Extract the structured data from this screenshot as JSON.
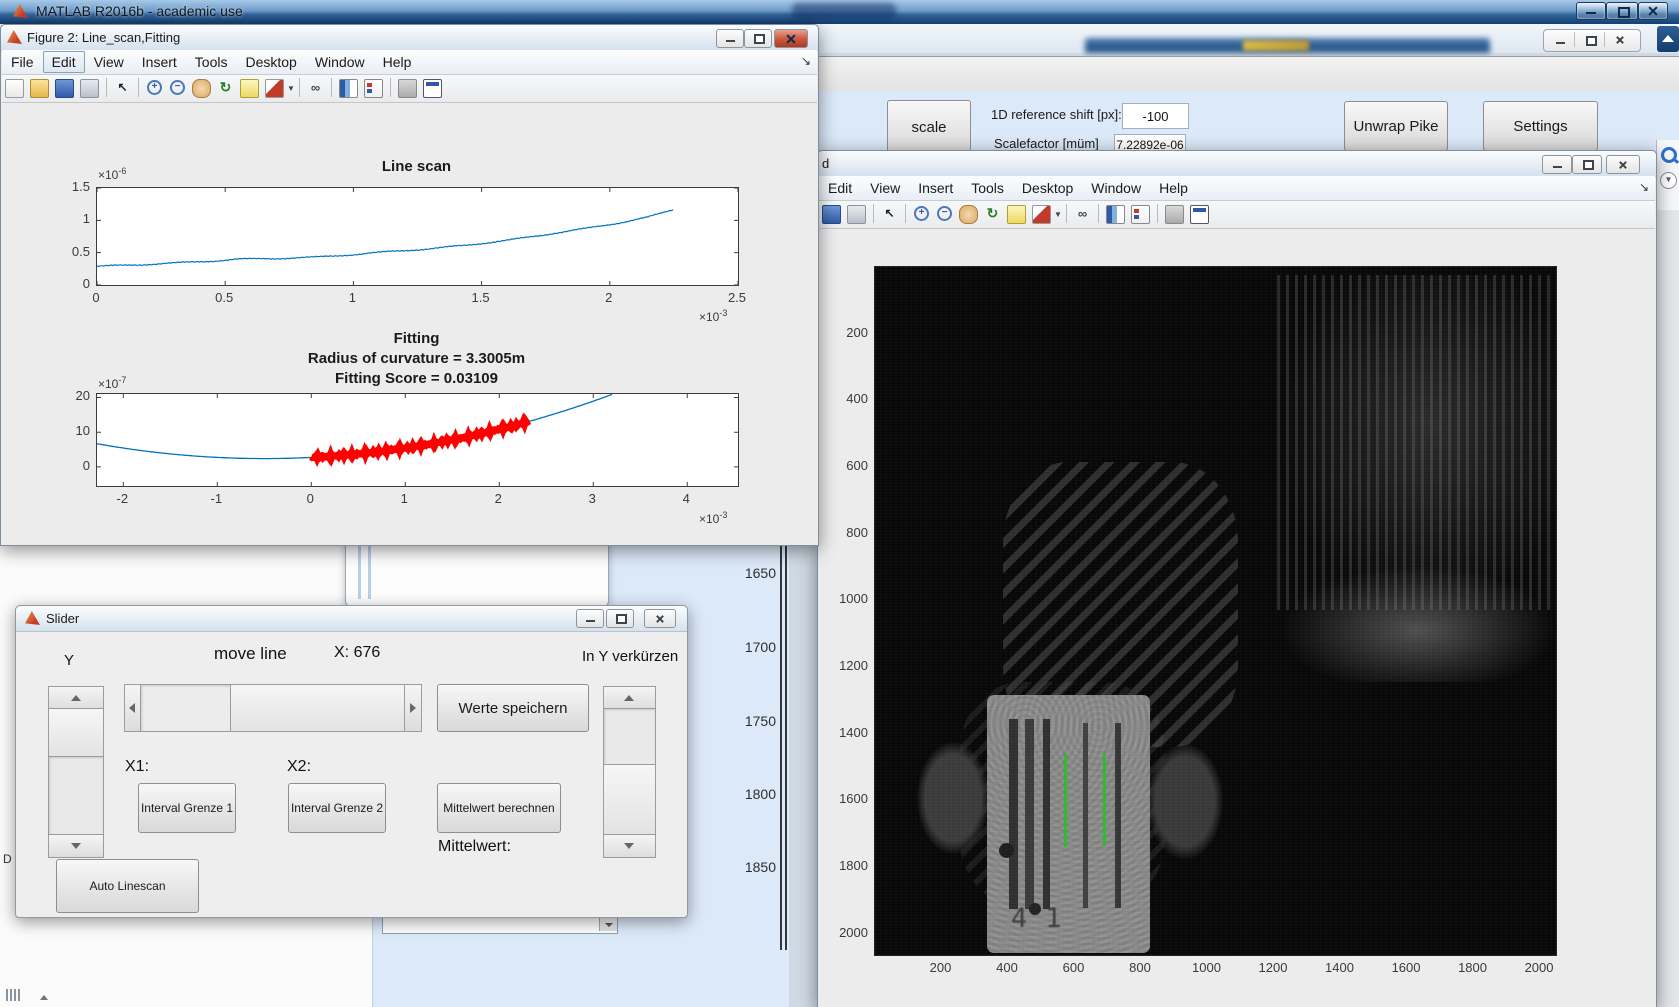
{
  "matlab": {
    "title": "MATLAB R2016b - academic use"
  },
  "fig2": {
    "title": "Figure 2: Line_scan,Fitting",
    "menu": [
      "File",
      "Edit",
      "View",
      "Insert",
      "Tools",
      "Desktop",
      "Window",
      "Help"
    ],
    "active_menu": "Edit",
    "toolbar": [
      "new-doc",
      "open-folder",
      "save",
      "print",
      "|",
      "cursor",
      "|",
      "zoom-in",
      "zoom-out",
      "pan-hand",
      "rotate-3d",
      "data-cursor",
      "brush",
      "drop",
      "|",
      "link-plot",
      "|",
      "insert-colorbar",
      "insert-legend",
      "|",
      "hold-plot",
      "dock-figure"
    ]
  },
  "imgwin": {
    "title_visible": "d",
    "menu": [
      "Edit",
      "View",
      "Insert",
      "Tools",
      "Desktop",
      "Window",
      "Help"
    ],
    "toolbar": [
      "save",
      "print",
      "|",
      "cursor",
      "|",
      "zoom-in",
      "zoom-out",
      "pan-hand",
      "rotate-3d",
      "data-cursor",
      "brush",
      "drop",
      "|",
      "link-plot",
      "|",
      "insert-colorbar",
      "insert-legend",
      "|",
      "hold-plot",
      "dock-figure"
    ]
  },
  "slider": {
    "title": "Slider",
    "y_label": "Y",
    "move_line": "move line",
    "x_value": "X: 676",
    "shorten": "In Y verkürzen",
    "save_btn": "Werte speichern",
    "x1_label": "X1:",
    "x2_label": "X2:",
    "interval1_btn": "Interval Grenze 1",
    "interval2_btn": "Interval Grenze 2",
    "mean_btn": "Mittelwert berechnen",
    "mean_label": "Mittelwert:",
    "auto_btn": "Auto Linescan"
  },
  "panel": {
    "scale_btn": "scale",
    "shift_label": "1D reference shift [px]:",
    "shift_value": "-100",
    "scalefactor_label": "Scalefactor [müm]",
    "scalefactor_value": "7.22892e-06",
    "unwrap_btn": "Unwrap Pike",
    "settings_btn": "Settings"
  },
  "background": {
    "axis_ticks": [
      1650,
      1700,
      1750,
      1800,
      1850
    ],
    "dock_letter": "D",
    "combo_value": ""
  },
  "chart_data": [
    {
      "type": "line",
      "name": "line_scan",
      "title": "Line scan",
      "x_exp_base": "×10",
      "x_exp_pow": "-3",
      "y_exp_base": "×10",
      "y_exp_pow": "-6",
      "xticks": [
        0,
        0.5,
        1,
        1.5,
        2,
        2.5
      ],
      "yticks": [
        0,
        0.5,
        1,
        1.5
      ],
      "xlim": [
        0,
        2.5
      ],
      "ylim": [
        0,
        1.5
      ],
      "color": "#0072BD",
      "noise_amplitude": 0.013,
      "x": [
        0,
        0.15,
        0.3,
        0.45,
        0.55,
        0.7,
        0.85,
        1.0,
        1.15,
        1.3,
        1.45,
        1.6,
        1.75,
        1.9,
        2.05,
        2.15,
        2.25
      ],
      "y": [
        0.29,
        0.31,
        0.34,
        0.37,
        0.4,
        0.41,
        0.43,
        0.47,
        0.52,
        0.56,
        0.62,
        0.69,
        0.78,
        0.87,
        0.97,
        1.05,
        1.17
      ]
    },
    {
      "type": "line",
      "name": "fitting",
      "title": "Fitting",
      "subtitle1": "Radius of curvature = 3.3005m",
      "subtitle2": "Fitting Score = 0.03109",
      "x_exp_base": "×10",
      "x_exp_pow": "-3",
      "y_exp_base": "×10",
      "y_exp_pow": "-7",
      "xticks": [
        -2,
        -1,
        0,
        1,
        2,
        3,
        4
      ],
      "yticks": [
        0,
        10,
        20
      ],
      "xlim": [
        -2.28,
        4.54
      ],
      "ylim": [
        -5.5,
        21
      ],
      "fit_color": "#0072BD",
      "data_color": "#FF0000",
      "parabola": {
        "a": 1.35,
        "x0": -0.5,
        "c": 2.4
      },
      "radius_of_curvature_m": 3.3005,
      "fitting_score": 0.03109,
      "data_range_x": [
        0,
        2.32
      ],
      "data_noise": 0.5
    },
    {
      "type": "heatmap",
      "name": "phase_image",
      "xticks": [
        200,
        400,
        600,
        800,
        1000,
        1200,
        1400,
        1600,
        1800,
        2000
      ],
      "yticks": [
        200,
        400,
        600,
        800,
        1000,
        1200,
        1400,
        1600,
        1800,
        2000
      ],
      "xlim": [
        0,
        2048
      ],
      "ylim": [
        0,
        2064
      ],
      "description": "dark interferogram: striped texture upper right, diagonal fringes center, bright chip structure lower left",
      "green_lines": [
        {
          "x": 573,
          "y1": 1460,
          "y2": 1740
        },
        {
          "x": 690,
          "y1": 1460,
          "y2": 1735
        }
      ],
      "green_color": "#19c819"
    }
  ]
}
